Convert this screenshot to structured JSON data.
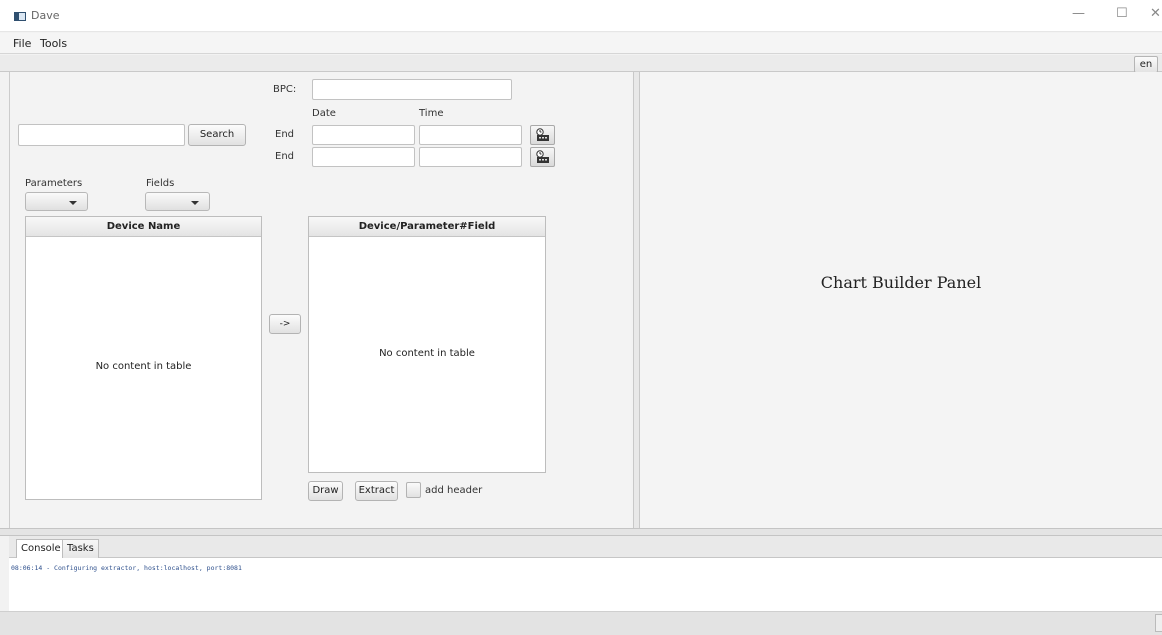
{
  "window": {
    "title": "Dave",
    "minimize": "—",
    "maximize": "☐",
    "close": "✕"
  },
  "menu": {
    "file": "File",
    "tools": "Tools"
  },
  "toolbar": {
    "language": "en"
  },
  "form": {
    "bpc_label": "BPC:",
    "bpc_value": "",
    "date_header": "Date",
    "time_header": "Time",
    "row1_label": "End",
    "row2_label": "End",
    "search_value": "",
    "search_button": "Search",
    "parameters_label": "Parameters",
    "fields_label": "Fields",
    "parameters_selected": "",
    "fields_selected": ""
  },
  "device_table": {
    "header": "Device Name",
    "empty_text": "No content in table"
  },
  "transfer_button": "->",
  "selection_table": {
    "header": "Device/Parameter#Field",
    "empty_text": "No content in table"
  },
  "actions": {
    "draw": "Draw",
    "extract": "Extract",
    "add_header": "add header",
    "add_header_checked": false
  },
  "chart_panel": {
    "title": "Chart Builder Panel"
  },
  "bottom_tabs": [
    {
      "label": "Console",
      "active": true
    },
    {
      "label": "Tasks",
      "active": false
    }
  ],
  "console": {
    "lines": [
      "08:06:14 - Configuring extractor, host:localhost, port:8081"
    ]
  }
}
